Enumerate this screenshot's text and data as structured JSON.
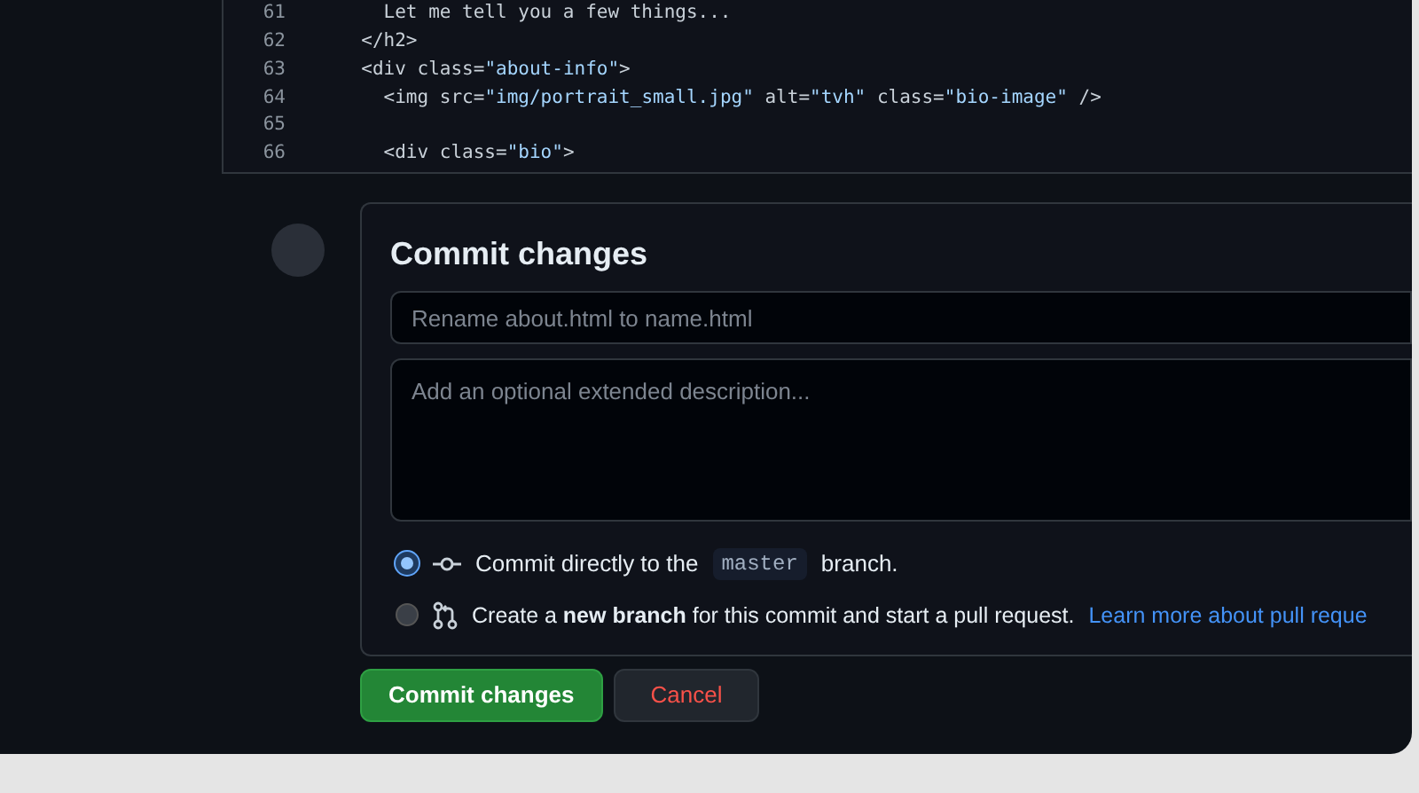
{
  "code_lines": [
    {
      "number": "61",
      "segments": [
        {
          "kind": "text",
          "text": "    Let me tell you a few things..."
        }
      ]
    },
    {
      "number": "62",
      "segments": [
        {
          "kind": "text",
          "text": "  </h2>"
        }
      ]
    },
    {
      "number": "63",
      "segments": [
        {
          "kind": "text",
          "text": "  <div class="
        },
        {
          "kind": "string",
          "text": "\"about-info\""
        },
        {
          "kind": "text",
          "text": ">"
        }
      ]
    },
    {
      "number": "64",
      "segments": [
        {
          "kind": "text",
          "text": "    <img src="
        },
        {
          "kind": "string",
          "text": "\"img/portrait_small.jpg\""
        },
        {
          "kind": "text",
          "text": " alt="
        },
        {
          "kind": "string",
          "text": "\"tvh\""
        },
        {
          "kind": "text",
          "text": " class="
        },
        {
          "kind": "string",
          "text": "\"bio-image\""
        },
        {
          "kind": "text",
          "text": " />"
        }
      ]
    },
    {
      "number": "65"
    },
    {
      "number": "66",
      "segments": [
        {
          "kind": "text",
          "text": "    <div class="
        },
        {
          "kind": "string",
          "text": "\"bio\""
        },
        {
          "kind": "text",
          "text": ">"
        }
      ]
    }
  ],
  "commit": {
    "title": "Commit changes",
    "summary_placeholder": "Rename about.html to name.html",
    "description_placeholder": "Add an optional extended description...",
    "options": [
      {
        "kind": "direct",
        "selected": true,
        "before": "Commit directly to the",
        "branch": "master",
        "after": "branch."
      },
      {
        "kind": "new_branch",
        "selected": false,
        "text": "Create a **new branch** for this commit and start a pull request.",
        "link": "Learn more about pull reque"
      }
    ],
    "buttons": [
      {
        "kind": "primary",
        "label": "Commit changes"
      },
      {
        "kind": "danger",
        "label": "Cancel"
      }
    ]
  }
}
